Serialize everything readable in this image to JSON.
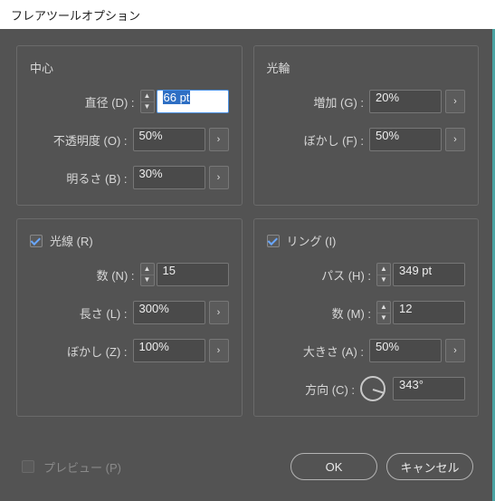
{
  "titlebar": {
    "title": "フレアツールオプション"
  },
  "center": {
    "title": "中心",
    "diameter_label": "直径 (D) :",
    "diameter_value": "66 pt",
    "opacity_label": "不透明度 (O) :",
    "opacity_value": "50%",
    "brightness_label": "明るさ (B) :",
    "brightness_value": "30%"
  },
  "halo": {
    "title": "光輪",
    "growth_label": "増加 (G) :",
    "growth_value": "20%",
    "fuzziness_label": "ぼかし (F) :",
    "fuzziness_value": "50%"
  },
  "rays": {
    "title": "光線 (R)",
    "count_label": "数 (N) :",
    "count_value": "15",
    "length_label": "長さ (L) :",
    "length_value": "300%",
    "fuzziness_label": "ぼかし (Z) :",
    "fuzziness_value": "100%"
  },
  "rings": {
    "title": "リング (I)",
    "path_label": "パス (H) :",
    "path_value": "349 pt",
    "count_label": "数 (M) :",
    "count_value": "12",
    "size_label": "大きさ (A) :",
    "size_value": "50%",
    "direction_label": "方向 (C) :",
    "direction_value": "343°",
    "direction_angle_deg": 343
  },
  "footer": {
    "preview_label": "プレビュー (P)",
    "ok_label": "OK",
    "cancel_label": "キャンセル"
  }
}
